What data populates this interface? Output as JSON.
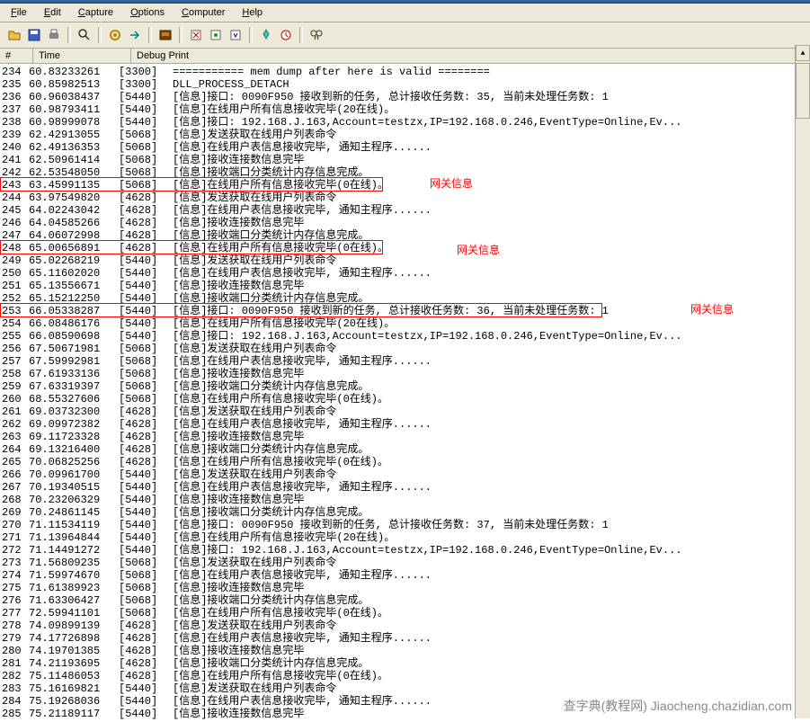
{
  "menus": [
    "File",
    "Edit",
    "Capture",
    "Options",
    "Computer",
    "Help"
  ],
  "menu_hotkeys": [
    "F",
    "E",
    "C",
    "O",
    "C",
    "H"
  ],
  "headers": {
    "num": "#",
    "time": "Time",
    "debug": "Debug Print"
  },
  "annotations": {
    "label": "网关信息"
  },
  "watermark": "查字典(教程网)\nJiaocheng.chazidian.com",
  "rows": [
    {
      "n": "234",
      "t": "60.83233261",
      "p": "[3300]",
      "m": "=========== mem dump after here is valid ========"
    },
    {
      "n": "235",
      "t": "60.85982513",
      "p": "[3300]",
      "m": "DLL_PROCESS_DETACH"
    },
    {
      "n": "236",
      "t": "60.96038437",
      "p": "[5440]",
      "m": "[信息]接口: 0090F950 接收到新的任务, 总计接收任务数: 35, 当前未处理任务数: 1"
    },
    {
      "n": "237",
      "t": "60.98793411",
      "p": "[5440]",
      "m": "[信息]在线用户所有信息接收完毕(20在线)。"
    },
    {
      "n": "238",
      "t": "60.98999078",
      "p": "[5440]",
      "m": "[信息]接口: 192.168.J.163,Account=testzx,IP=192.168.0.246,EventType=Online,Ev..."
    },
    {
      "n": "239",
      "t": "62.42913055",
      "p": "[5068]",
      "m": "[信息]发送获取在线用户列表命令"
    },
    {
      "n": "240",
      "t": "62.49136353",
      "p": "[5068]",
      "m": "[信息]在线用户表信息接收完毕, 通知主程序......"
    },
    {
      "n": "241",
      "t": "62.50961414",
      "p": "[5068]",
      "m": "[信息]接收连接数信息完毕"
    },
    {
      "n": "242",
      "t": "62.53548050",
      "p": "[5068]",
      "m": "[信息]接收端口分类统计内存信息完成。"
    },
    {
      "n": "243",
      "t": "63.45991135",
      "p": "[5068]",
      "m": "[信息]在线用户所有信息接收完毕(0在线)。",
      "hl": 1
    },
    {
      "n": "244",
      "t": "63.97549820",
      "p": "[4628]",
      "m": "[信息]发送获取在线用户列表命令"
    },
    {
      "n": "245",
      "t": "64.02243042",
      "p": "[4628]",
      "m": "[信息]在线用户表信息接收完毕, 通知主程序......"
    },
    {
      "n": "246",
      "t": "64.04585266",
      "p": "[4628]",
      "m": "[信息]接收连接数信息完毕"
    },
    {
      "n": "247",
      "t": "64.06072998",
      "p": "[4628]",
      "m": "[信息]接收端口分类统计内存信息完成。"
    },
    {
      "n": "248",
      "t": "65.00656891",
      "p": "[4628]",
      "m": "[信息]在线用户所有信息接收完毕(0在线)。",
      "hl": 2
    },
    {
      "n": "249",
      "t": "65.02268219",
      "p": "[5440]",
      "m": "[信息]发送获取在线用户列表命令"
    },
    {
      "n": "250",
      "t": "65.11602020",
      "p": "[5440]",
      "m": "[信息]在线用户表信息接收完毕, 通知主程序......"
    },
    {
      "n": "251",
      "t": "65.13556671",
      "p": "[5440]",
      "m": "[信息]接收连接数信息完毕"
    },
    {
      "n": "252",
      "t": "65.15212250",
      "p": "[5440]",
      "m": "[信息]接收端口分类统计内存信息完成。"
    },
    {
      "n": "253",
      "t": "66.05338287",
      "p": "[5440]",
      "m": "[信息]接口: 0090F950 接收到新的任务, 总计接收任务数: 36, 当前未处理任务数: 1",
      "hl": 3
    },
    {
      "n": "254",
      "t": "66.08486176",
      "p": "[5440]",
      "m": "[信息]在线用户所有信息接收完毕(20在线)。"
    },
    {
      "n": "255",
      "t": "66.08590698",
      "p": "[5440]",
      "m": "[信息]接口: 192.168.J.163,Account=testzx,IP=192.168.0.246,EventType=Online,Ev..."
    },
    {
      "n": "256",
      "t": "67.50671981",
      "p": "[5068]",
      "m": "[信息]发送获取在线用户列表命令"
    },
    {
      "n": "257",
      "t": "67.59992981",
      "p": "[5068]",
      "m": "[信息]在线用户表信息接收完毕, 通知主程序......"
    },
    {
      "n": "258",
      "t": "67.61933136",
      "p": "[5068]",
      "m": "[信息]接收连接数信息完毕"
    },
    {
      "n": "259",
      "t": "67.63319397",
      "p": "[5068]",
      "m": "[信息]接收端口分类统计内存信息完成。"
    },
    {
      "n": "260",
      "t": "68.55327606",
      "p": "[5068]",
      "m": "[信息]在线用户所有信息接收完毕(0在线)。"
    },
    {
      "n": "261",
      "t": "69.03732300",
      "p": "[4628]",
      "m": "[信息]发送获取在线用户列表命令"
    },
    {
      "n": "262",
      "t": "69.09972382",
      "p": "[4628]",
      "m": "[信息]在线用户表信息接收完毕, 通知主程序......"
    },
    {
      "n": "263",
      "t": "69.11723328",
      "p": "[4628]",
      "m": "[信息]接收连接数信息完毕"
    },
    {
      "n": "264",
      "t": "69.13216400",
      "p": "[4628]",
      "m": "[信息]接收端口分类统计内存信息完成。"
    },
    {
      "n": "265",
      "t": "70.06825256",
      "p": "[4628]",
      "m": "[信息]在线用户所有信息接收完毕(0在线)。"
    },
    {
      "n": "266",
      "t": "70.09961700",
      "p": "[5440]",
      "m": "[信息]发送获取在线用户列表命令"
    },
    {
      "n": "267",
      "t": "70.19340515",
      "p": "[5440]",
      "m": "[信息]在线用户表信息接收完毕, 通知主程序......"
    },
    {
      "n": "268",
      "t": "70.23206329",
      "p": "[5440]",
      "m": "[信息]接收连接数信息完毕"
    },
    {
      "n": "269",
      "t": "70.24861145",
      "p": "[5440]",
      "m": "[信息]接收端口分类统计内存信息完成。"
    },
    {
      "n": "270",
      "t": "71.11534119",
      "p": "[5440]",
      "m": "[信息]接口: 0090F950 接收到新的任务, 总计接收任务数: 37, 当前未处理任务数: 1"
    },
    {
      "n": "271",
      "t": "71.13964844",
      "p": "[5440]",
      "m": "[信息]在线用户所有信息接收完毕(20在线)。"
    },
    {
      "n": "272",
      "t": "71.14491272",
      "p": "[5440]",
      "m": "[信息]接口: 192.168.J.163,Account=testzx,IP=192.168.0.246,EventType=Online,Ev..."
    },
    {
      "n": "273",
      "t": "71.56809235",
      "p": "[5068]",
      "m": "[信息]发送获取在线用户列表命令"
    },
    {
      "n": "274",
      "t": "71.59974670",
      "p": "[5068]",
      "m": "[信息]在线用户表信息接收完毕, 通知主程序......"
    },
    {
      "n": "275",
      "t": "71.61389923",
      "p": "[5068]",
      "m": "[信息]接收连接数信息完毕"
    },
    {
      "n": "276",
      "t": "71.63306427",
      "p": "[5068]",
      "m": "[信息]接收端口分类统计内存信息完成。"
    },
    {
      "n": "277",
      "t": "72.59941101",
      "p": "[5068]",
      "m": "[信息]在线用户所有信息接收完毕(0在线)。"
    },
    {
      "n": "278",
      "t": "74.09899139",
      "p": "[4628]",
      "m": "[信息]发送获取在线用户列表命令"
    },
    {
      "n": "279",
      "t": "74.17726898",
      "p": "[4628]",
      "m": "[信息]在线用户表信息接收完毕, 通知主程序......"
    },
    {
      "n": "280",
      "t": "74.19701385",
      "p": "[4628]",
      "m": "[信息]接收连接数信息完毕"
    },
    {
      "n": "281",
      "t": "74.21193695",
      "p": "[4628]",
      "m": "[信息]接收端口分类统计内存信息完成。"
    },
    {
      "n": "282",
      "t": "75.11486053",
      "p": "[4628]",
      "m": "[信息]在线用户所有信息接收完毕(0在线)。"
    },
    {
      "n": "283",
      "t": "75.16169821",
      "p": "[5440]",
      "m": "[信息]发送获取在线用户列表命令"
    },
    {
      "n": "284",
      "t": "75.19268036",
      "p": "[5440]",
      "m": "[信息]在线用户表信息接收完毕, 通知主程序......"
    },
    {
      "n": "285",
      "t": "75.21189117",
      "p": "[5440]",
      "m": "[信息]接收连接数信息完毕"
    }
  ]
}
